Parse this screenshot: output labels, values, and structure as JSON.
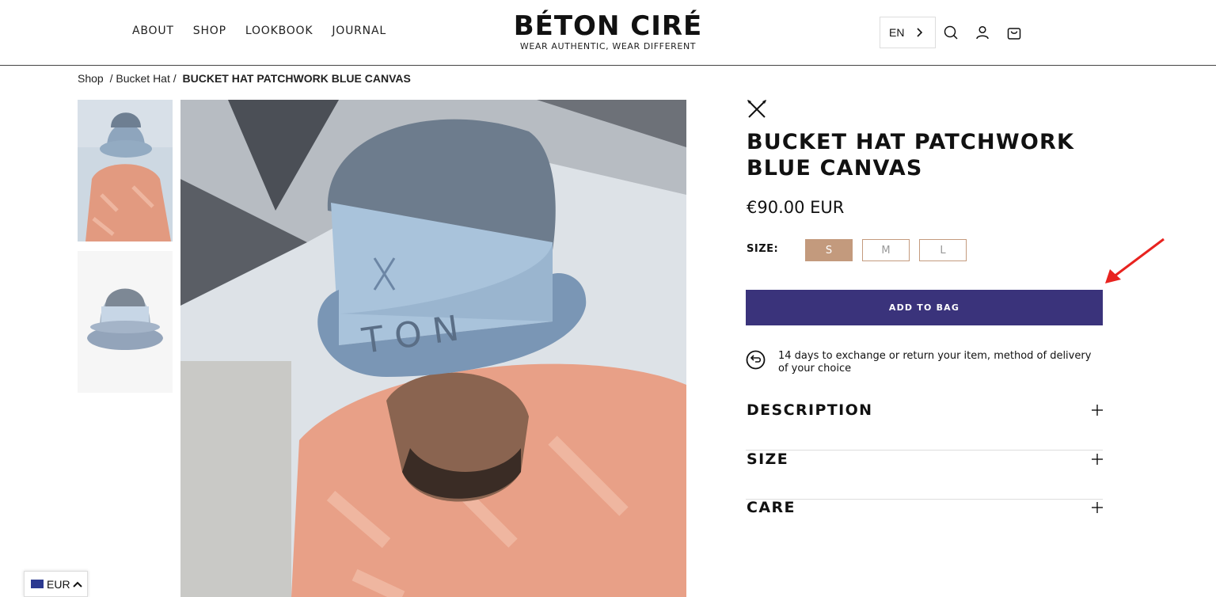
{
  "header": {
    "nav": [
      "ABOUT",
      "SHOP",
      "LOOKBOOK",
      "JOURNAL"
    ],
    "brand": "BÉTON CIRÉ",
    "tagline": "WEAR AUTHENTIC, WEAR DIFFERENT",
    "language": "EN",
    "icons": [
      "search-icon",
      "account-icon",
      "bag-icon"
    ]
  },
  "breadcrumb": {
    "items": [
      "Shop",
      "/ Bucket Hat /"
    ],
    "current": "BUCKET HAT PATCHWORK BLUE CANVAS"
  },
  "product": {
    "title": "BUCKET HAT PATCHWORK BLUE CANVAS",
    "price": "€90.00 EUR",
    "size_label": "SIZE:",
    "sizes": [
      "S",
      "M",
      "L"
    ],
    "selected_size": "S",
    "add_to_bag": "ADD TO BAG",
    "returns": "14 days to exchange or return your item, method of delivery of your choice",
    "accordions": [
      "DESCRIPTION",
      "SIZE",
      "CARE"
    ]
  },
  "currency": {
    "code": "EUR"
  },
  "colors": {
    "accent": "#3a337b",
    "size_selected": "#c39a7d",
    "arrow": "#e8231f"
  }
}
